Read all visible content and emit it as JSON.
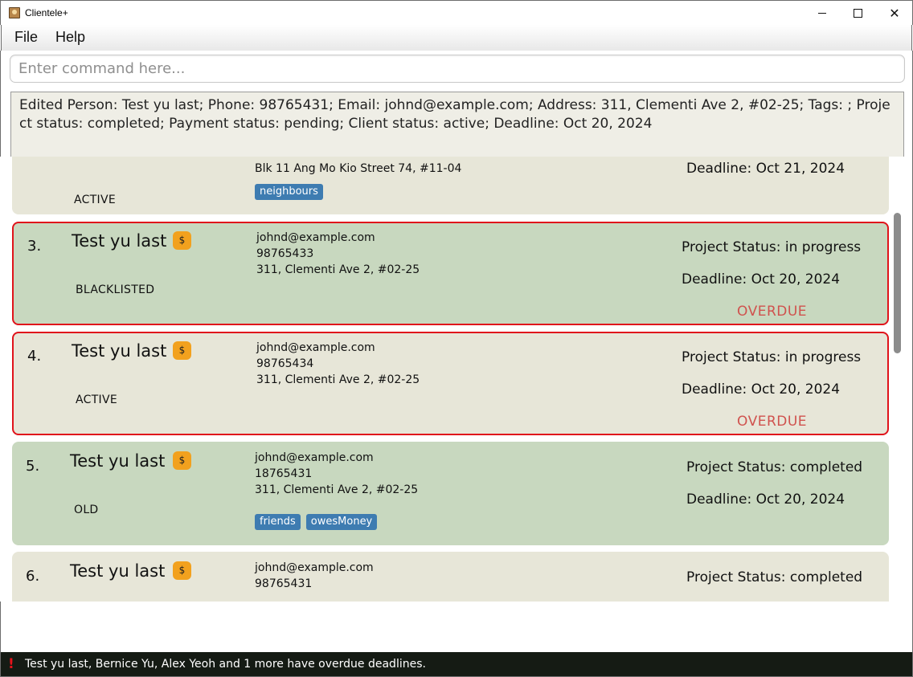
{
  "window": {
    "title": "Clientele+",
    "minimize_icon": "minimize-icon",
    "maximize_icon": "maximize-icon",
    "close_icon": "close-icon",
    "close_glyph": "✕"
  },
  "menu": {
    "items": [
      {
        "label": "File"
      },
      {
        "label": "Help"
      }
    ]
  },
  "command": {
    "placeholder": "Enter command here..."
  },
  "result": {
    "text": "Edited Person: Test yu last; Phone: 98765431; Email: johnd@example.com; Address: 311, Clementi Ave 2, #02-25; Tags: ; Project status: completed; Payment status: pending; Client status: active; Deadline: Oct 20, 2024"
  },
  "persons": [
    {
      "partial_name_fragment": "",
      "address": "Blk 11 Ang Mo Kio Street 74, #11-04",
      "client_status": "ACTIVE",
      "tags": [
        "neighbours"
      ],
      "deadline": "Deadline: Oct 21, 2024"
    },
    {
      "index": "3.",
      "name": "Test yu last",
      "payment_icon": "$",
      "email": "johnd@example.com",
      "phone": "98765433",
      "address": "311, Clementi Ave 2, #02-25",
      "client_status": "BLACKLISTED",
      "project_status": "Project Status: in progress",
      "deadline": "Deadline: Oct 20, 2024",
      "overdue": "OVERDUE"
    },
    {
      "index": "4.",
      "name": "Test yu last",
      "payment_icon": "$",
      "email": "johnd@example.com",
      "phone": "98765434",
      "address": "311, Clementi Ave 2, #02-25",
      "client_status": "ACTIVE",
      "project_status": "Project Status: in progress",
      "deadline": "Deadline: Oct 20, 2024",
      "overdue": "OVERDUE"
    },
    {
      "index": "5.",
      "name": "Test yu last",
      "payment_icon": "$",
      "email": "johnd@example.com",
      "phone": "18765431",
      "address": "311, Clementi Ave 2, #02-25",
      "client_status": "OLD",
      "tags": [
        "friends",
        "owesMoney"
      ],
      "project_status": "Project Status: completed",
      "deadline": "Deadline: Oct 20, 2024"
    },
    {
      "index": "6.",
      "name": "Test yu last",
      "payment_icon": "$",
      "email": "johnd@example.com",
      "phone": "98765431",
      "project_status": "Project Status: completed"
    }
  ],
  "statusbar": {
    "icon": "!",
    "text": "Test yu last, Bernice Yu, Alex Yeoh and 1 more have overdue deadlines."
  },
  "colors": {
    "card_beige": "#e7e6d8",
    "card_green": "#c8d8bf",
    "overdue_border": "#e0131b",
    "overdue_text": "#d0524e",
    "tag_blue": "#3e7cb1",
    "payment_badge": "#f2a11e",
    "statusbar_bg": "#151b14"
  }
}
